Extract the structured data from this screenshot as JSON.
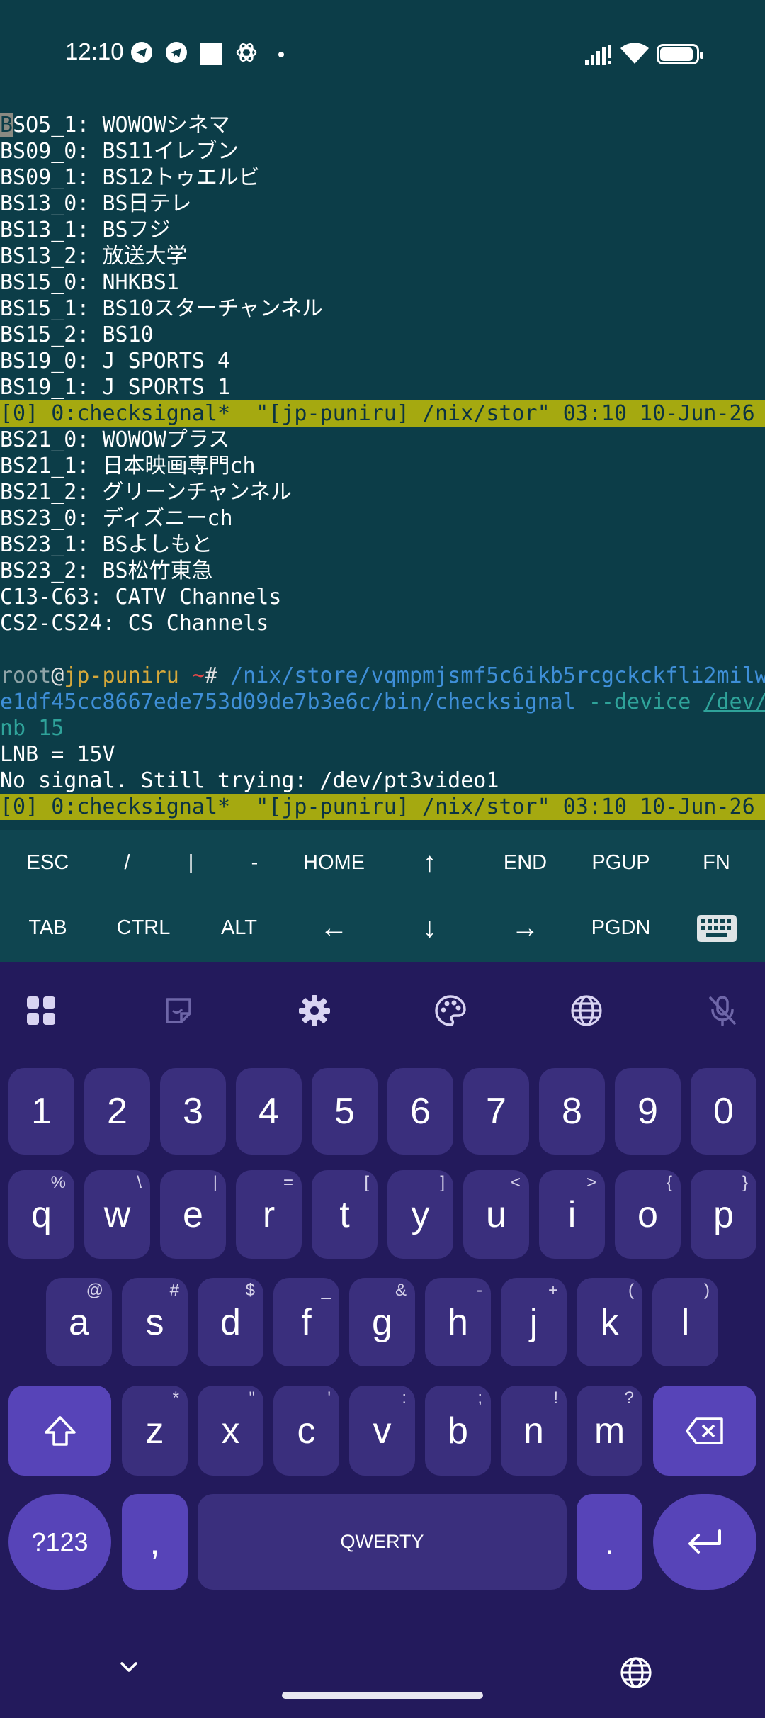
{
  "status_bar": {
    "time": "12:10",
    "icons": [
      "telegram-icon",
      "telegram-icon",
      "square-notification-icon",
      "chatgpt-icon",
      "dot-icon",
      "signal-icon",
      "wifi-icon",
      "battery-icon"
    ]
  },
  "terminal": {
    "lines_top": [
      "SO5_1: WOWOWシネマ",
      "BS09_0: BS11イレブン",
      "BS09_1: BS12トゥエルビ",
      "BS13_0: BS日テレ",
      "BS13_1: BSフジ",
      "BS13_2: 放送大学",
      "BS15_0: NHKBS1",
      "BS15_1: BS10スターチャンネル",
      "BS15_2: BS10",
      "BS19_0: J SPORTS 4",
      "BS19_1: J SPORTS 1"
    ],
    "cursor_char": "B",
    "tmux_status": "[0] 0:checksignal*  \"[jp-puniru] /nix/stor\" 03:10 10-Jun-26",
    "lines_mid": [
      "BS21_0: WOWOWプラス",
      "BS21_1: 日本映画専門ch",
      "BS21_2: グリーンチャンネル",
      "BS23_0: ディズニーch",
      "BS23_1: BSよしもと",
      "BS23_2: BS松竹東急",
      "C13-C63: CATV Channels",
      "CS2-CS24: CS Channels"
    ],
    "prompt": {
      "user": "root",
      "at": "@",
      "host": "jp-puniru",
      "tilde": " ~",
      "hash": "# ",
      "path_1": "/nix/store/vqmpmjsmf5c6ikb5rcgckckfli2milw",
      "path_2": "e1df45cc8667ede753d09de7b3e6c/bin/checksignal",
      "arg_1": " --device ",
      "device_link": "/dev/",
      "arg_2": "nb 15"
    },
    "output_lines": [
      "LNB = 15V",
      "No signal. Still trying: /dev/pt3video1"
    ],
    "tmux_status_bottom": "[0] 0:checksignal*  \"[jp-puniru] /nix/stor\" 03:10 10-Jun-26"
  },
  "extra_keys": {
    "row1": [
      "ESC",
      "/",
      "|",
      "-",
      "HOME",
      "↑",
      "END",
      "PGUP",
      "FN"
    ],
    "row2": [
      "TAB",
      "CTRL",
      "ALT",
      "←",
      "↓",
      "→",
      "PGDN",
      "keyboard-icon"
    ]
  },
  "keyboard": {
    "toolbar": [
      "apps-grid-icon",
      "sticker-icon",
      "settings-gear-icon",
      "palette-icon",
      "globe-icon",
      "mic-off-icon"
    ],
    "number_row": [
      "1",
      "2",
      "3",
      "4",
      "5",
      "6",
      "7",
      "8",
      "9",
      "0"
    ],
    "row_q": [
      {
        "k": "q",
        "s": "%"
      },
      {
        "k": "w",
        "s": "\\"
      },
      {
        "k": "e",
        "s": "|"
      },
      {
        "k": "r",
        "s": "="
      },
      {
        "k": "t",
        "s": "["
      },
      {
        "k": "y",
        "s": "]"
      },
      {
        "k": "u",
        "s": "<"
      },
      {
        "k": "i",
        "s": ">"
      },
      {
        "k": "o",
        "s": "{"
      },
      {
        "k": "p",
        "s": "}"
      }
    ],
    "row_a": [
      {
        "k": "a",
        "s": "@"
      },
      {
        "k": "s",
        "s": "#"
      },
      {
        "k": "d",
        "s": "$"
      },
      {
        "k": "f",
        "s": "_"
      },
      {
        "k": "g",
        "s": "&"
      },
      {
        "k": "h",
        "s": "-"
      },
      {
        "k": "j",
        "s": "+"
      },
      {
        "k": "k",
        "s": "("
      },
      {
        "k": "l",
        "s": ")"
      }
    ],
    "row_z": [
      {
        "k": "z",
        "s": "*"
      },
      {
        "k": "x",
        "s": "\""
      },
      {
        "k": "c",
        "s": "'"
      },
      {
        "k": "v",
        "s": ":"
      },
      {
        "k": "b",
        "s": ";"
      },
      {
        "k": "n",
        "s": "!"
      },
      {
        "k": "m",
        "s": "?"
      }
    ],
    "symbols_label": "?123",
    "comma": ",",
    "space_label": "QWERTY",
    "period": "."
  },
  "nav": [
    "chevron-down-icon",
    "globe-icon"
  ],
  "colors": {
    "terminal_bg": "#0c3d48",
    "tmux_bar": "#a5a910",
    "keyboard_bg": "#231a5c",
    "key": "#3a2f7d",
    "key_accent": "#5744b8"
  }
}
